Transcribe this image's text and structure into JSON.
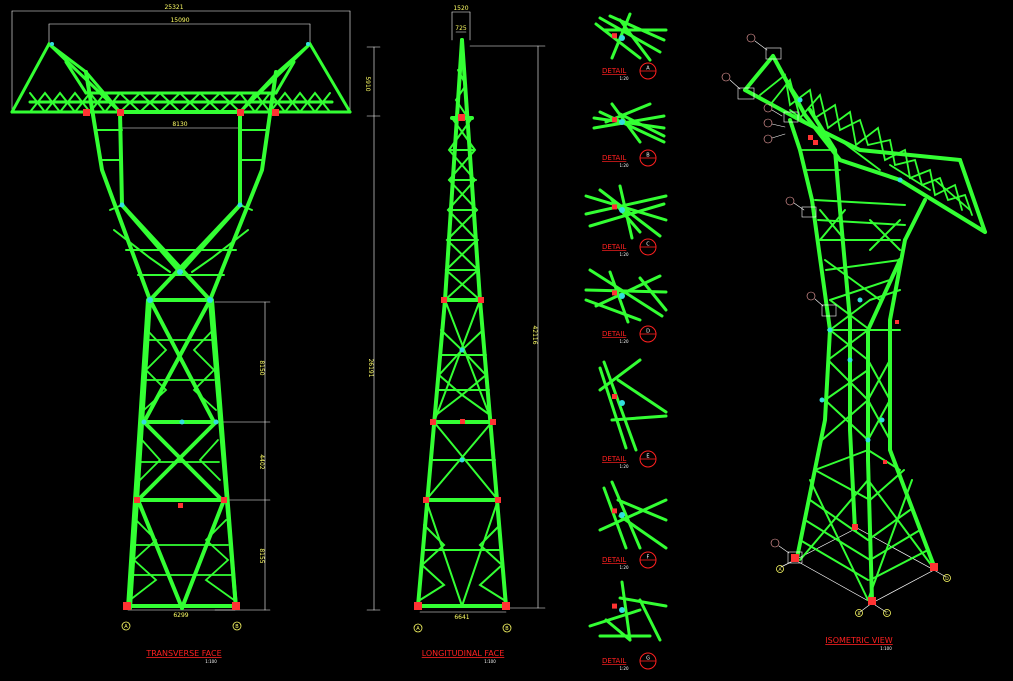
{
  "colors": {
    "background": "#000000",
    "member": "#33ff33",
    "dimension": "#ffffff",
    "dimension_text": "#ffff66",
    "title": "#ff2020",
    "bolt": "#33dddd",
    "support": "#ff3333"
  },
  "transverse": {
    "title": "TRANSVERSE FACE",
    "scale": "1:100",
    "dim_top": "25321",
    "dim_top2": "15090",
    "dim_height_arm": "5910",
    "dim_waist": "8130",
    "dim_total": "26191",
    "dim_seg1": "8150",
    "dim_seg2": "4402",
    "dim_seg3": "8155",
    "dim_base": "6299",
    "legs": [
      "A",
      "B"
    ]
  },
  "longitudinal": {
    "title": "LONGITUDINAL FACE",
    "scale": "1:100",
    "dim_top": "1520",
    "dim_top2": "725",
    "dim_total": "42116",
    "dim_base": "6641",
    "legs": [
      "A",
      "B"
    ]
  },
  "details": [
    {
      "label": "DETAIL",
      "id": "A",
      "scale": "1:20"
    },
    {
      "label": "DETAIL",
      "id": "B",
      "scale": "1:20"
    },
    {
      "label": "DETAIL",
      "id": "C",
      "scale": "1:20"
    },
    {
      "label": "DETAIL",
      "id": "D",
      "scale": "1:20"
    },
    {
      "label": "DETAIL",
      "id": "E",
      "scale": "1:20"
    },
    {
      "label": "DETAIL",
      "id": "F",
      "scale": "1:20"
    },
    {
      "label": "DETAIL",
      "id": "G",
      "scale": "1:20"
    }
  ],
  "isometric": {
    "title": "ISOMETRIC VIEW",
    "scale": "1:100",
    "legs": [
      "A",
      "B",
      "C",
      "D"
    ]
  }
}
